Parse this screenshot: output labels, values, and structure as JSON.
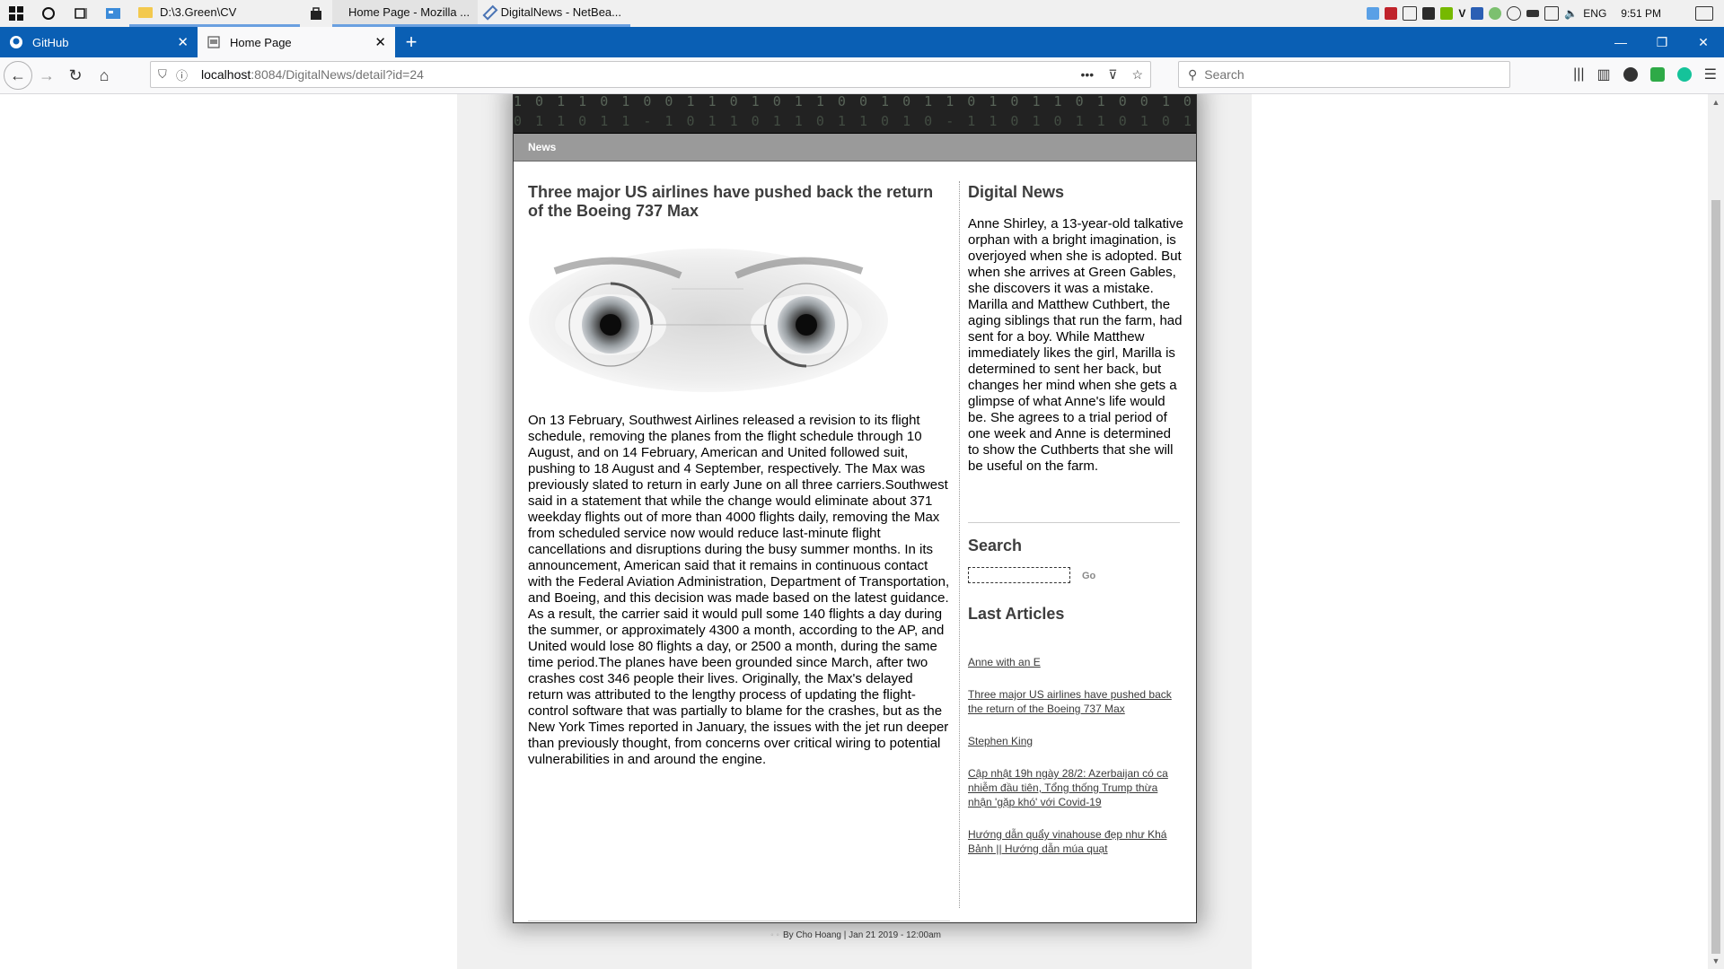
{
  "taskbar": {
    "apps": [
      {
        "label": "D:\\3.Green\\CV"
      },
      {
        "label": "Home Page - Mozilla ..."
      },
      {
        "label": "DigitalNews - NetBea..."
      }
    ],
    "language": "ENG",
    "time": "9:51 PM"
  },
  "browser": {
    "tabs": [
      {
        "label": "GitHub"
      },
      {
        "label": "Home Page"
      }
    ],
    "url_host": "localhost",
    "url_path": ":8084/DigitalNews/detail?id=24",
    "search_placeholder": "Search"
  },
  "site": {
    "menu": [
      "News"
    ],
    "article": {
      "title": "Three major US airlines have pushed back the return of the Boeing 737 Max",
      "body": "On 13 February, Southwest Airlines released a revision to its flight schedule, removing the planes from the flight schedule through 10 August, and on 14 February, American and United followed suit, pushing to 18 August and 4 September, respectively. The Max was previously slated to return in early June on all three carriers.Southwest said in a statement that while the change would eliminate about 371 weekday flights out of more than 4000 flights daily, removing the Max from scheduled service now would reduce last-minute flight cancellations and disruptions during the busy summer months. In its announcement, American said that it remains in continuous contact with the Federal Aviation Administration, Department of Transportation, and Boeing, and this decision was made based on the latest guidance. As a result, the carrier said it would pull some 140 flights a day during the summer, or approximately 4300 a month, according to the AP, and United would lose 80 flights a day, or 2500 a month, during the same time period.The planes have been grounded since March, after two crashes cost 346 people their lives. Originally, the Max's delayed return was attributed to the lengthy process of updating the flight-control software that was partially to blame for the crashes, but as the New York Times reported in January, the issues with the jet run deeper than previously thought, from concerns over critical wiring to potential vulnerabilities in and around the engine.",
      "byline": "By Cho Hoang | Jan 21 2019 - 12:00am"
    },
    "sidebar": {
      "about_heading": "Digital News",
      "about_text": "Anne Shirley, a 13-year-old talkative orphan with a bright imagination, is overjoyed when she is adopted. But when she arrives at Green Gables, she discovers it was a mistake. Marilla and Matthew Cuthbert, the aging siblings that run the farm, had sent for a boy. While Matthew immediately likes the girl, Marilla is determined to sent her back, but changes her mind when she gets a glimpse of what Anne's life would be. She agrees to a trial period of one week and Anne is determined to show the Cuthberts that she will be useful on the farm.",
      "search_heading": "Search",
      "search_button": "Go",
      "articles_heading": "Last Articles",
      "articles": [
        "Anne with an E",
        "Three major US airlines have pushed back the return of the Boeing 737 Max",
        "Stephen King",
        "Cập nhật 19h ngày 28/2: Azerbaijan có ca nhiễm đầu tiên, Tổng thống Trump thừa nhận 'gặp khó' với Covid-19",
        "Hướng dẫn quẩy vinahouse đẹp như Khá Bảnh || Hướng dẫn múa quạt"
      ]
    }
  },
  "colors": {
    "tabstrip": "#0a5fb4",
    "menubar": "#9a9a9a",
    "heading": "#3d3d3d"
  }
}
